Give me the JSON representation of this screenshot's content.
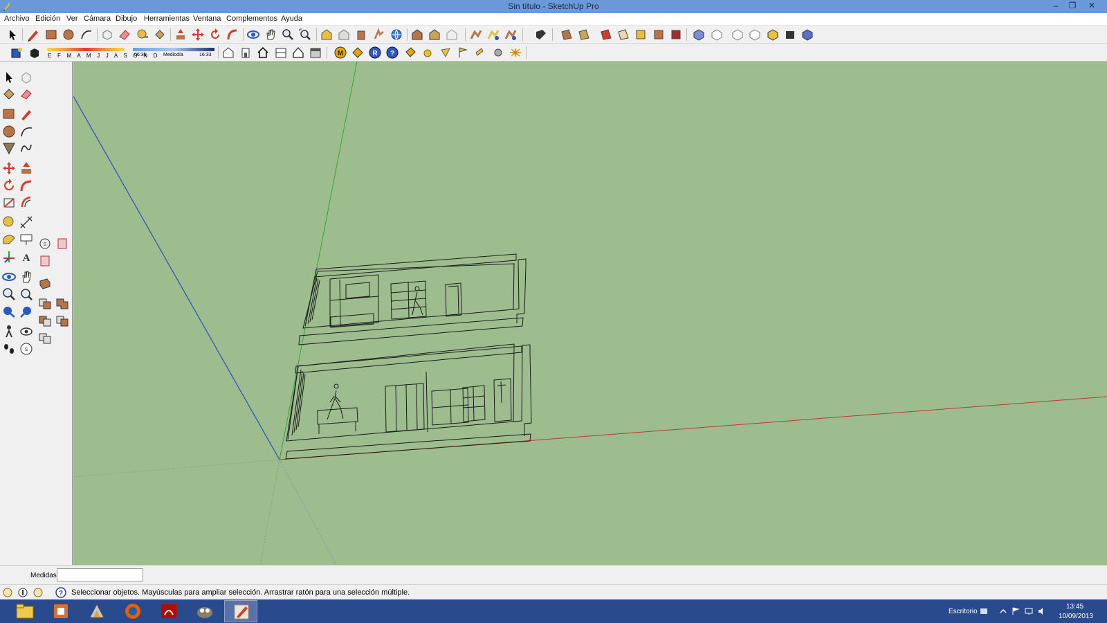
{
  "window": {
    "title": "Sin título - SketchUp Pro",
    "app_icon": "sketchup-pencil-icon",
    "controls": [
      "minimize-icon",
      "restore-icon",
      "close-icon"
    ]
  },
  "menu": {
    "items": [
      "Archivo",
      "Edición",
      "Ver",
      "Cámara",
      "Dibujo",
      "Herramientas",
      "Ventana",
      "Complementos",
      "Ayuda"
    ]
  },
  "shadows": {
    "months": "E F M A M J J A S O N D",
    "time_start": "06:35",
    "time_mid": "Mediodía",
    "time_end": "16:33"
  },
  "measurements": {
    "label": "Medidas",
    "value": ""
  },
  "status": {
    "message": "Seleccionar objetos. Mayúsculas para ampliar selección. Arrastrar ratón para una selección múltiple."
  },
  "taskbar": {
    "apps": [
      "file-explorer-icon",
      "office-icon",
      "autocad-icon",
      "firefox-icon",
      "acrobat-icon",
      "gimp-icon",
      "sketchup-icon"
    ],
    "active_app": "sketchup-icon",
    "desktop_label": "Escritorio",
    "time": "13:45",
    "date": "10/09/2013"
  },
  "colors": {
    "viewport_bg": "#9dbd8e",
    "titlebar": "#6b98d9",
    "taskbar": "#2a4a8e",
    "axis_red": "#c0392b",
    "axis_green": "#2fa82f",
    "axis_blue": "#2b4fbf"
  }
}
